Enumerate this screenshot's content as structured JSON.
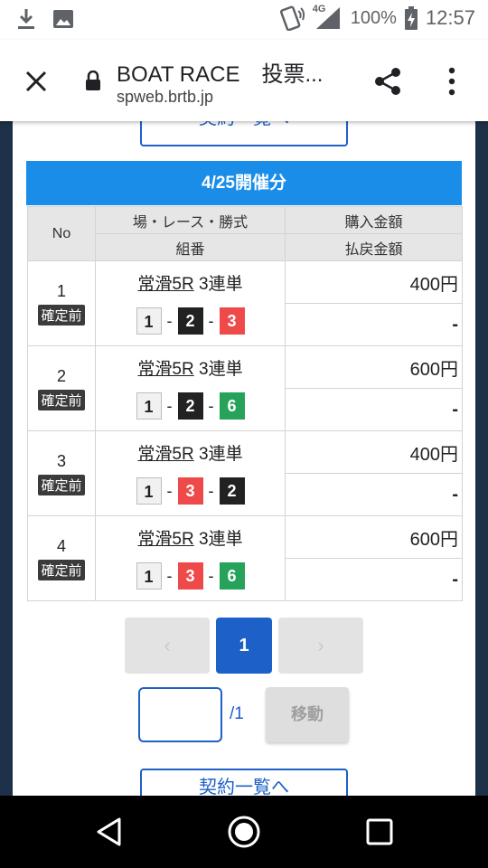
{
  "status_bar": {
    "signal_label": "4G",
    "battery_percent": "100%",
    "time": "12:57",
    "icons": [
      "download-icon",
      "image-icon",
      "vibrate-icon",
      "signal-icon",
      "battery-charging-icon"
    ]
  },
  "browser": {
    "title": "BOAT RACE　投票...",
    "url": "spweb.brtb.jp",
    "icons": [
      "close-icon",
      "lock-icon",
      "share-icon",
      "more-vert-icon"
    ]
  },
  "page": {
    "top_button_label": "契約一覧へ",
    "date_header": "4/25開催分",
    "table": {
      "headers": {
        "no": "No",
        "venue_race_type": "場・レース・勝式",
        "combination": "組番",
        "purchase_amount": "購入金額",
        "payout_amount": "払戻金額"
      },
      "rows": [
        {
          "no": "1",
          "status": "確定前",
          "venue_race": "常滑5R",
          "bet_type": "3連単",
          "combo": [
            "1",
            "2",
            "3"
          ],
          "purchase": "400円",
          "payout": "-"
        },
        {
          "no": "2",
          "status": "確定前",
          "venue_race": "常滑5R",
          "bet_type": "3連単",
          "combo": [
            "1",
            "2",
            "6"
          ],
          "purchase": "600円",
          "payout": "-"
        },
        {
          "no": "3",
          "status": "確定前",
          "venue_race": "常滑5R",
          "bet_type": "3連単",
          "combo": [
            "1",
            "3",
            "2"
          ],
          "purchase": "400円",
          "payout": "-"
        },
        {
          "no": "4",
          "status": "確定前",
          "venue_race": "常滑5R",
          "bet_type": "3連単",
          "combo": [
            "1",
            "3",
            "6"
          ],
          "purchase": "600円",
          "payout": "-"
        }
      ]
    },
    "pager": {
      "prev": "‹",
      "current": "1",
      "next": "›",
      "input_value": "",
      "total": "/1",
      "move_label": "移動"
    },
    "bottom_button_label": "契約一覧へ"
  },
  "colors": {
    "header_blue": "#1a8de8",
    "button_blue": "#1d60c8",
    "boat_1": "#f1f1f1",
    "boat_2": "#222222",
    "boat_3": "#ef4a4a",
    "boat_6": "#27a25a"
  }
}
